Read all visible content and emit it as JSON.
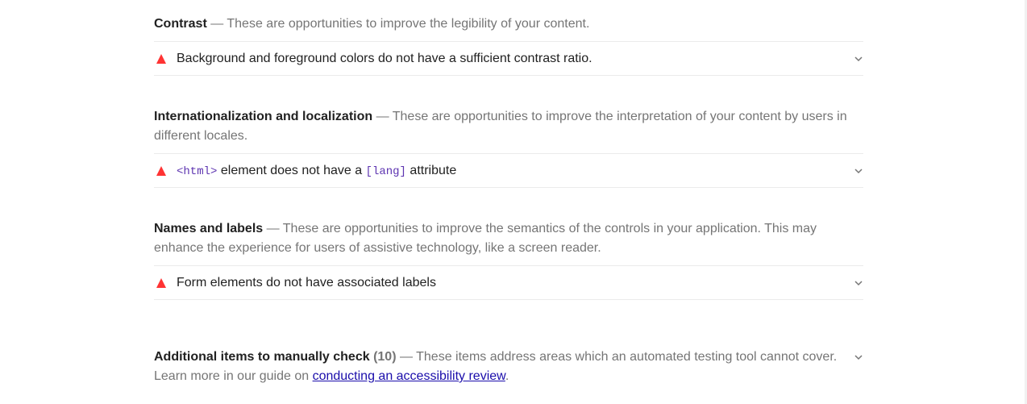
{
  "top_clip": {
    "text": "o improve the interpretation of your content by users in different locales."
  },
  "groups": [
    {
      "title": "Contrast",
      "description": " — These are opportunities to improve the legibility of your content.",
      "audit": {
        "text": "Background and foreground colors do not have a sufficient contrast ratio."
      }
    },
    {
      "title": "Internationalization and localization",
      "description": " — These are opportunities to improve the interpretation of your content by users in different locales.",
      "audit": {
        "code1": "<html>",
        "text1": " element does not have a ",
        "code2": "[lang]",
        "text2": " attribute"
      }
    },
    {
      "title": "Names and labels",
      "description": " — These are opportunities to improve the semantics of the controls in your application. This may enhance the experience for users of assistive technology, like a screen reader.",
      "audit": {
        "text": "Form elements do not have associated labels"
      }
    }
  ],
  "manual": {
    "title": "Additional items to manually check",
    "count": "(10)",
    "description": "  — These items address areas which an automated testing tool cannot cover.",
    "learn_more_prefix": "Learn more in our guide on ",
    "link_text": "conducting an accessibility review",
    "learn_more_suffix": "."
  },
  "icons": {
    "fail": "fail-triangle-icon",
    "expand": "chevron-down-icon"
  },
  "colors": {
    "fail": "#ff3333",
    "code": "#5e35b1",
    "link": "#1a0dab",
    "muted": "#757575"
  }
}
